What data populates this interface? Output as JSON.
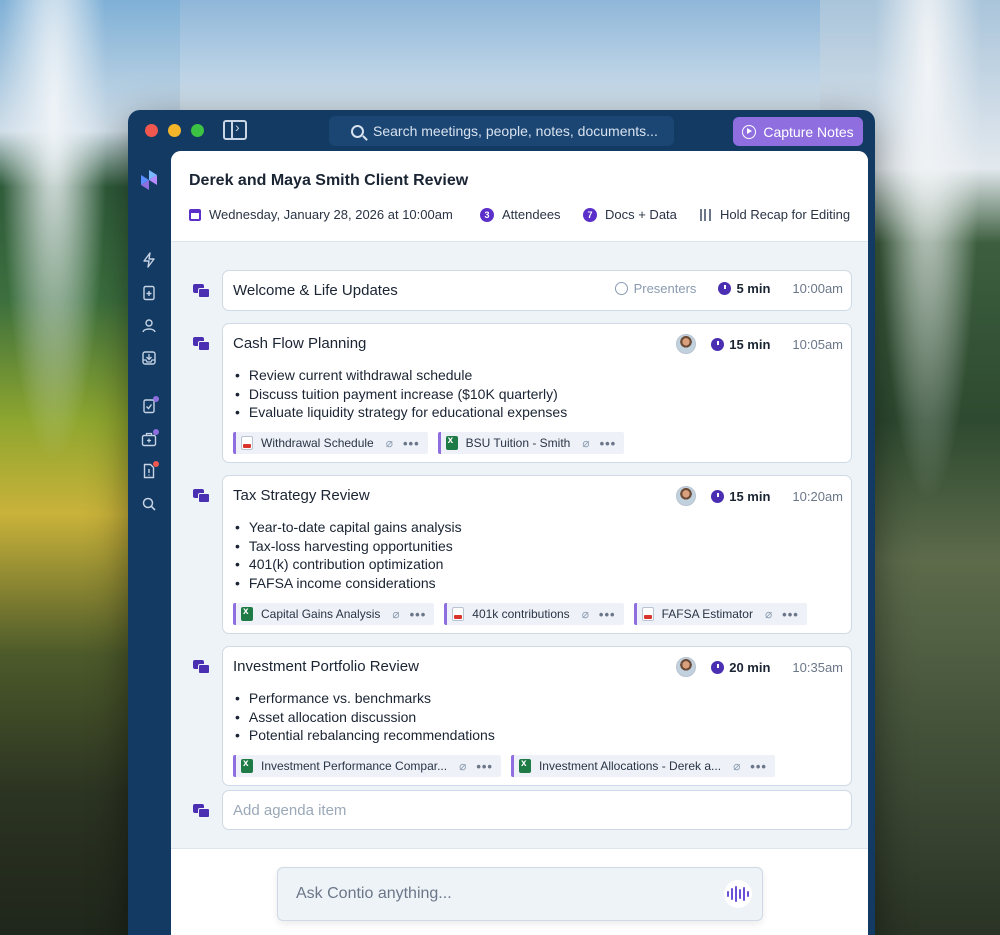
{
  "search": {
    "placeholder": "Search meetings, people, notes, documents..."
  },
  "capture_label": "Capture Notes",
  "meeting": {
    "title": "Derek and Maya Smith Client Review",
    "date": "Wednesday, January 28, 2026 at 10:00am",
    "attendees_count": "3",
    "attendees_label": "Attendees",
    "docs_count": "7",
    "docs_label": "Docs + Data",
    "hold_label": "Hold Recap for Editing"
  },
  "agenda": [
    {
      "title": "Welcome & Life Updates",
      "presenters_label": "Presenters",
      "duration": "5 min",
      "time": "10:00am"
    },
    {
      "title": "Cash Flow Planning",
      "duration": "15 min",
      "time": "10:05am",
      "bullets": [
        "Review current withdrawal schedule",
        "Discuss tuition payment increase ($10K quarterly)",
        "Evaluate liquidity strategy for educational expenses"
      ],
      "attachments": [
        {
          "name": "Withdrawal Schedule",
          "type": "pdf"
        },
        {
          "name": "BSU Tuition - Smith",
          "type": "xls"
        }
      ]
    },
    {
      "title": "Tax Strategy Review",
      "duration": "15 min",
      "time": "10:20am",
      "bullets": [
        "Year-to-date capital gains analysis",
        "Tax-loss harvesting opportunities",
        "401(k) contribution optimization",
        "FAFSA income considerations"
      ],
      "attachments": [
        {
          "name": "Capital Gains Analysis",
          "type": "xls"
        },
        {
          "name": "401k contributions",
          "type": "pdf"
        },
        {
          "name": "FAFSA Estimator",
          "type": "pdf"
        }
      ]
    },
    {
      "title": "Investment Portfolio Review",
      "duration": "20 min",
      "time": "10:35am",
      "bullets": [
        "Performance vs. benchmarks",
        "Asset allocation discussion",
        "Potential rebalancing recommendations"
      ],
      "attachments": [
        {
          "name": "Investment Performance Compar...",
          "type": "xls"
        },
        {
          "name": "Investment Allocations - Derek a...",
          "type": "xls"
        }
      ]
    }
  ],
  "add_item_placeholder": "Add agenda item",
  "ask_placeholder": "Ask Contio anything...",
  "more_glyph": "•••",
  "colors": {
    "accent": "#4a2fb3",
    "capture": "#8f6fe0",
    "window": "#123a63",
    "badge_red": "#f0574f",
    "badge_purple": "#8f6fe0"
  }
}
